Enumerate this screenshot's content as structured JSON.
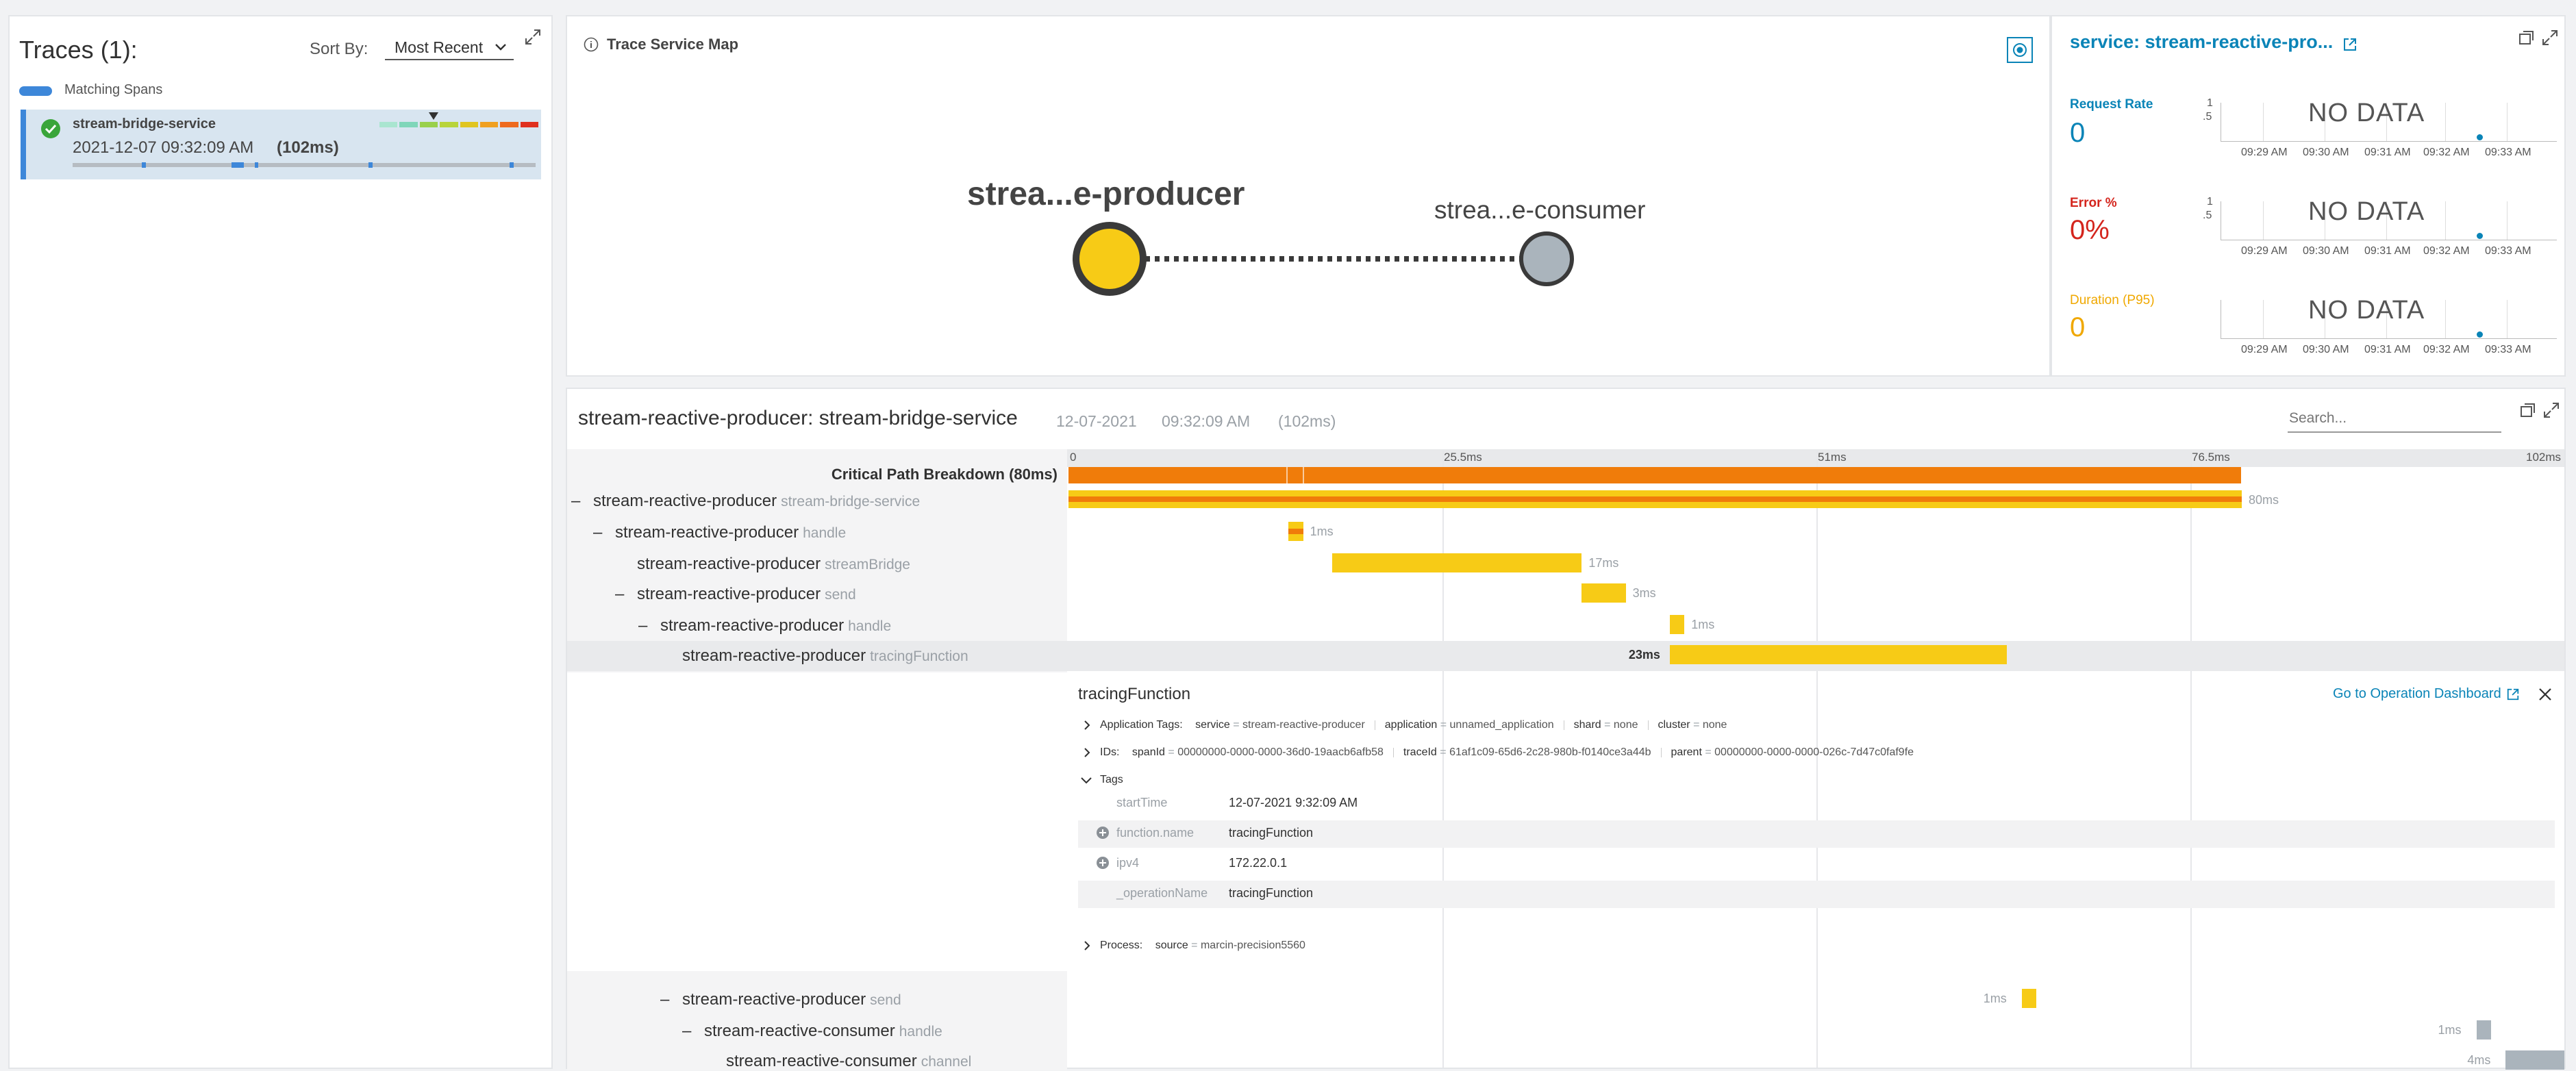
{
  "left": {
    "title": "Traces (1):",
    "sort_label": "Sort By:",
    "sort_value": "Most Recent",
    "matching_spans_label": "Matching Spans",
    "trace_item": {
      "service": "stream-bridge-service",
      "timestamp": "2021-12-07 09:32:09 AM",
      "duration": "(102ms)",
      "status": "success"
    }
  },
  "map": {
    "title": "Trace Service Map",
    "source_node": "strea...e-producer",
    "target_node": "strea...e-consumer"
  },
  "metrics": {
    "service_title": "service: stream-reactive-pro...",
    "request_rate": {
      "label": "Request Rate",
      "value": "0",
      "color": "#0a84b7"
    },
    "error": {
      "label": "Error %",
      "value": "0%",
      "color": "#d4251d"
    },
    "duration": {
      "label": "Duration (P95)",
      "value": "0",
      "color": "#f0a800"
    },
    "no_data": "NO DATA",
    "y_ticks": [
      "1",
      ".5"
    ],
    "x_ticks": [
      "09:29 AM",
      "09:30 AM",
      "09:31 AM",
      "09:32 AM",
      "09:33 AM"
    ]
  },
  "trace": {
    "title": "stream-reactive-producer: stream-bridge-service",
    "date": "12-07-2021",
    "time": "09:32:09 AM",
    "duration": "(102ms)",
    "search_placeholder": "Search...",
    "critical_path_label": "Critical Path Breakdown (80ms)",
    "timeline_ticks": [
      "0",
      "25.5ms",
      "51ms",
      "76.5ms",
      "102ms"
    ],
    "spans": [
      {
        "collapse": "–",
        "service": "stream-reactive-producer",
        "op": "stream-bridge-service",
        "dur": "80ms",
        "start": 0,
        "len": 80
      },
      {
        "collapse": "–",
        "service": "stream-reactive-producer",
        "op": "handle",
        "dur": "1ms",
        "start": 15,
        "len": 1
      },
      {
        "collapse": "",
        "service": "stream-reactive-producer",
        "op": "streamBridge",
        "dur": "17ms",
        "start": 18,
        "len": 17
      },
      {
        "collapse": "–",
        "service": "stream-reactive-producer",
        "op": "send",
        "dur": "3ms",
        "start": 35,
        "len": 3
      },
      {
        "collapse": "–",
        "service": "stream-reactive-producer",
        "op": "handle",
        "dur": "1ms",
        "start": 41,
        "len": 1
      },
      {
        "collapse": "",
        "service": "stream-reactive-producer",
        "op": "tracingFunction",
        "dur": "23ms",
        "start": 41,
        "len": 23
      },
      {
        "collapse": "–",
        "service": "stream-reactive-producer",
        "op": "send",
        "dur": "1ms",
        "start": 65,
        "len": 1
      },
      {
        "collapse": "–",
        "service": "stream-reactive-consumer",
        "op": "handle",
        "dur": "1ms",
        "start": 96,
        "len": 1
      },
      {
        "collapse": "",
        "service": "stream-reactive-consumer",
        "op": "channel",
        "dur": "4ms",
        "start": 98,
        "len": 4
      }
    ],
    "details": {
      "name": "tracingFunction",
      "dashboard_link": "Go to Operation Dashboard",
      "app_tags_label": "Application Tags:",
      "app_tags": [
        {
          "k": "service",
          "v": "stream-reactive-producer"
        },
        {
          "k": "application",
          "v": "unnamed_application"
        },
        {
          "k": "shard",
          "v": "none"
        },
        {
          "k": "cluster",
          "v": "none"
        }
      ],
      "ids_label": "IDs:",
      "ids": [
        {
          "k": "spanId",
          "v": "00000000-0000-0000-36d0-19aacb6afb58"
        },
        {
          "k": "traceId",
          "v": "61af1c09-65d6-2c28-980b-f0140ce3a44b"
        },
        {
          "k": "parent",
          "v": "00000000-0000-0000-026c-7d47c0faf9fe"
        }
      ],
      "tags_label": "Tags",
      "tags": [
        {
          "k": "startTime",
          "v": "12-07-2021 9:32:09 AM"
        },
        {
          "k": "function.name",
          "v": "tracingFunction"
        },
        {
          "k": "ipv4",
          "v": "172.22.0.1"
        },
        {
          "k": "_operationName",
          "v": "tracingFunction"
        }
      ],
      "process_label": "Process:",
      "process": [
        {
          "k": "source",
          "v": "marcin-precision5560"
        }
      ]
    }
  },
  "colors": {
    "accent": "#0a84b7",
    "critical": "#f07c0a",
    "span": "#f7cb16",
    "consumer_span": "#aab4bc",
    "node_producer": "#f7cb16",
    "node_consumer": "#aab4bc"
  }
}
